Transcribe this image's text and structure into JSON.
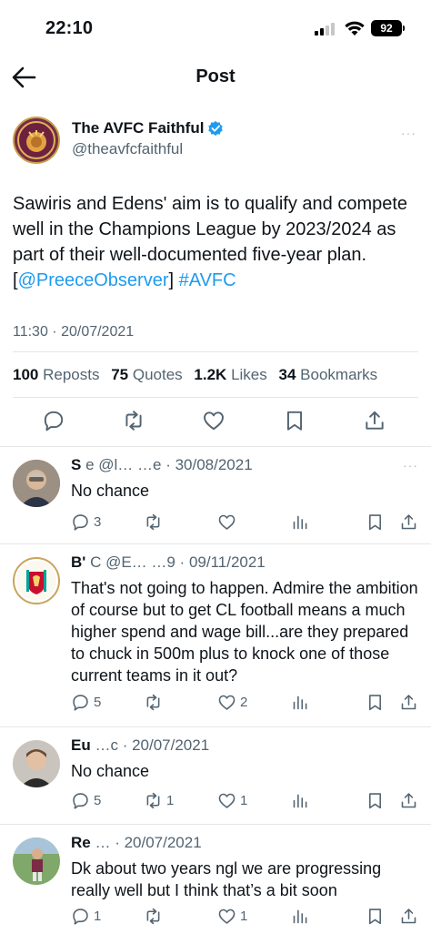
{
  "status_bar": {
    "time": "22:10",
    "battery": "92"
  },
  "header": {
    "title": "Post"
  },
  "post": {
    "author_name": "The AVFC Faithful",
    "author_handle": "@theavfcfaithful",
    "avatar_text": "THE AVFC FAITHFUL",
    "more": "···",
    "text_main": "Sawiris and Edens' aim is to qualify and compete well in the Champions League by 2023/2024 as part of their well-documented five-year plan. [",
    "mention": "@PreeceObserver",
    "text_after_mention": "]  ",
    "hashtag": "#AVFC",
    "timestamp": "11:30 · 20/07/2021",
    "stats": {
      "reposts_count": "100",
      "reposts_label": "Reposts",
      "quotes_count": "75",
      "quotes_label": "Quotes",
      "likes_count": "1.2K",
      "likes_label": "Likes",
      "bookmarks_count": "34",
      "bookmarks_label": "Bookmarks"
    }
  },
  "replies": [
    {
      "name": "S",
      "meta": "e @l…  …e · 30/08/2021",
      "text": "No chance",
      "replies": "3",
      "reposts": "",
      "likes": ""
    },
    {
      "name": "B'",
      "meta": "C @E…  …9 · 09/11/2021",
      "text": "That's not going to happen. Admire the ambition of course but to get CL football means a much higher spend and wage bill...are they prepared to chuck in 500m plus to knock one of those current teams in it out?",
      "replies": "5",
      "reposts": "",
      "likes": "2"
    },
    {
      "name": "Eu",
      "meta": "…c · 20/07/2021",
      "text": "No chance",
      "replies": "5",
      "reposts": "1",
      "likes": "1"
    },
    {
      "name": "Re",
      "meta": "… · 20/07/2021",
      "text": "Dk about two years ngl we are progressing really well but I think that’s a bit soon",
      "replies": "1",
      "reposts": "",
      "likes": "1"
    }
  ],
  "colors": {
    "accent": "#1d9bf0",
    "text": "#0f1419",
    "muted": "#536471",
    "divider": "#e3e7ea"
  }
}
